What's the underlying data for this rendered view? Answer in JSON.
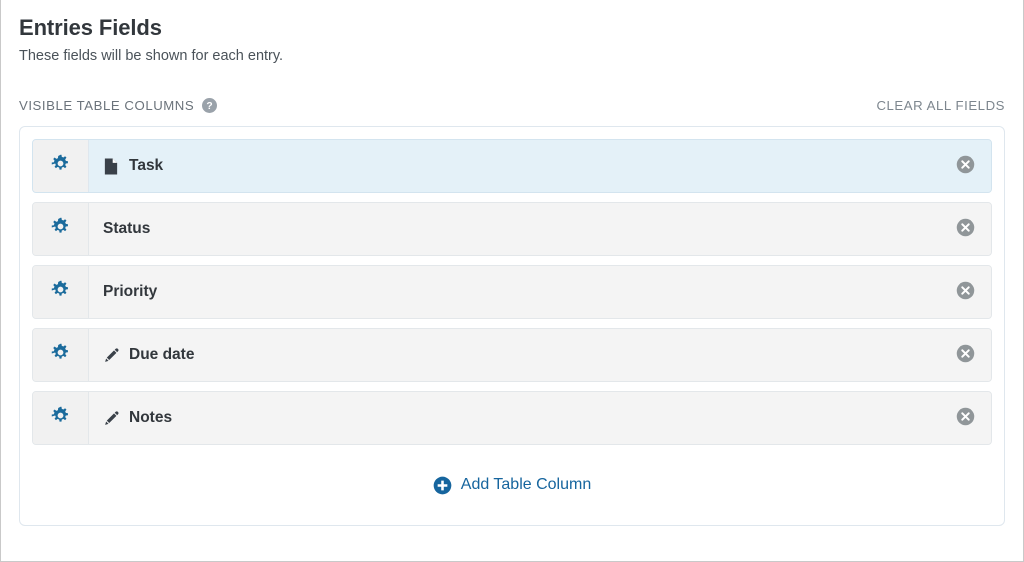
{
  "header": {
    "title": "Entries Fields",
    "subtitle": "These fields will be shown for each entry."
  },
  "section": {
    "label": "VISIBLE TABLE COLUMNS",
    "help_icon": "help-circle-icon",
    "clear_all_label": "CLEAR ALL FIELDS"
  },
  "fields": [
    {
      "label": "Task",
      "icon": "document-icon",
      "gear_icon": "gear-icon",
      "remove_icon": "remove-circle-icon",
      "selected": true
    },
    {
      "label": "Status",
      "icon": "none",
      "gear_icon": "gear-icon",
      "remove_icon": "remove-circle-icon",
      "selected": false
    },
    {
      "label": "Priority",
      "icon": "none",
      "gear_icon": "gear-icon",
      "remove_icon": "remove-circle-icon",
      "selected": false
    },
    {
      "label": "Due date",
      "icon": "pencil-icon",
      "gear_icon": "gear-icon",
      "remove_icon": "remove-circle-icon",
      "selected": false
    },
    {
      "label": "Notes",
      "icon": "pencil-icon",
      "gear_icon": "gear-icon",
      "remove_icon": "remove-circle-icon",
      "selected": false
    }
  ],
  "add_button": {
    "label": "Add Table Column",
    "icon": "plus-circle-icon"
  },
  "colors": {
    "accent_blue": "#16659e",
    "gear_blue": "#1b6b9c",
    "selected_row_bg": "#e4f1f8",
    "row_bg": "#f4f4f4",
    "title_text": "#32373c",
    "muted_text": "#6b737b",
    "remove_icon_gray": "#909699",
    "panel_border": "#dfe7ee"
  }
}
